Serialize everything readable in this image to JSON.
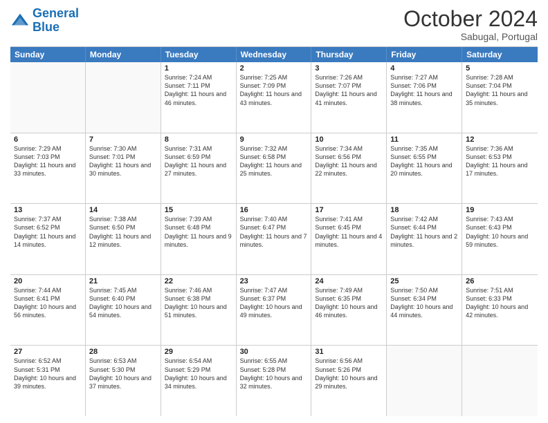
{
  "logo": {
    "line1": "General",
    "line2": "Blue"
  },
  "header": {
    "month": "October 2024",
    "location": "Sabugal, Portugal"
  },
  "weekdays": [
    "Sunday",
    "Monday",
    "Tuesday",
    "Wednesday",
    "Thursday",
    "Friday",
    "Saturday"
  ],
  "rows": [
    [
      {
        "day": "",
        "sunrise": "",
        "sunset": "",
        "daylight": "",
        "empty": true
      },
      {
        "day": "",
        "sunrise": "",
        "sunset": "",
        "daylight": "",
        "empty": true
      },
      {
        "day": "1",
        "sunrise": "Sunrise: 7:24 AM",
        "sunset": "Sunset: 7:11 PM",
        "daylight": "Daylight: 11 hours and 46 minutes."
      },
      {
        "day": "2",
        "sunrise": "Sunrise: 7:25 AM",
        "sunset": "Sunset: 7:09 PM",
        "daylight": "Daylight: 11 hours and 43 minutes."
      },
      {
        "day": "3",
        "sunrise": "Sunrise: 7:26 AM",
        "sunset": "Sunset: 7:07 PM",
        "daylight": "Daylight: 11 hours and 41 minutes."
      },
      {
        "day": "4",
        "sunrise": "Sunrise: 7:27 AM",
        "sunset": "Sunset: 7:06 PM",
        "daylight": "Daylight: 11 hours and 38 minutes."
      },
      {
        "day": "5",
        "sunrise": "Sunrise: 7:28 AM",
        "sunset": "Sunset: 7:04 PM",
        "daylight": "Daylight: 11 hours and 35 minutes."
      }
    ],
    [
      {
        "day": "6",
        "sunrise": "Sunrise: 7:29 AM",
        "sunset": "Sunset: 7:03 PM",
        "daylight": "Daylight: 11 hours and 33 minutes."
      },
      {
        "day": "7",
        "sunrise": "Sunrise: 7:30 AM",
        "sunset": "Sunset: 7:01 PM",
        "daylight": "Daylight: 11 hours and 30 minutes."
      },
      {
        "day": "8",
        "sunrise": "Sunrise: 7:31 AM",
        "sunset": "Sunset: 6:59 PM",
        "daylight": "Daylight: 11 hours and 27 minutes."
      },
      {
        "day": "9",
        "sunrise": "Sunrise: 7:32 AM",
        "sunset": "Sunset: 6:58 PM",
        "daylight": "Daylight: 11 hours and 25 minutes."
      },
      {
        "day": "10",
        "sunrise": "Sunrise: 7:34 AM",
        "sunset": "Sunset: 6:56 PM",
        "daylight": "Daylight: 11 hours and 22 minutes."
      },
      {
        "day": "11",
        "sunrise": "Sunrise: 7:35 AM",
        "sunset": "Sunset: 6:55 PM",
        "daylight": "Daylight: 11 hours and 20 minutes."
      },
      {
        "day": "12",
        "sunrise": "Sunrise: 7:36 AM",
        "sunset": "Sunset: 6:53 PM",
        "daylight": "Daylight: 11 hours and 17 minutes."
      }
    ],
    [
      {
        "day": "13",
        "sunrise": "Sunrise: 7:37 AM",
        "sunset": "Sunset: 6:52 PM",
        "daylight": "Daylight: 11 hours and 14 minutes."
      },
      {
        "day": "14",
        "sunrise": "Sunrise: 7:38 AM",
        "sunset": "Sunset: 6:50 PM",
        "daylight": "Daylight: 11 hours and 12 minutes."
      },
      {
        "day": "15",
        "sunrise": "Sunrise: 7:39 AM",
        "sunset": "Sunset: 6:48 PM",
        "daylight": "Daylight: 11 hours and 9 minutes."
      },
      {
        "day": "16",
        "sunrise": "Sunrise: 7:40 AM",
        "sunset": "Sunset: 6:47 PM",
        "daylight": "Daylight: 11 hours and 7 minutes."
      },
      {
        "day": "17",
        "sunrise": "Sunrise: 7:41 AM",
        "sunset": "Sunset: 6:45 PM",
        "daylight": "Daylight: 11 hours and 4 minutes."
      },
      {
        "day": "18",
        "sunrise": "Sunrise: 7:42 AM",
        "sunset": "Sunset: 6:44 PM",
        "daylight": "Daylight: 11 hours and 2 minutes."
      },
      {
        "day": "19",
        "sunrise": "Sunrise: 7:43 AM",
        "sunset": "Sunset: 6:43 PM",
        "daylight": "Daylight: 10 hours and 59 minutes."
      }
    ],
    [
      {
        "day": "20",
        "sunrise": "Sunrise: 7:44 AM",
        "sunset": "Sunset: 6:41 PM",
        "daylight": "Daylight: 10 hours and 56 minutes."
      },
      {
        "day": "21",
        "sunrise": "Sunrise: 7:45 AM",
        "sunset": "Sunset: 6:40 PM",
        "daylight": "Daylight: 10 hours and 54 minutes."
      },
      {
        "day": "22",
        "sunrise": "Sunrise: 7:46 AM",
        "sunset": "Sunset: 6:38 PM",
        "daylight": "Daylight: 10 hours and 51 minutes."
      },
      {
        "day": "23",
        "sunrise": "Sunrise: 7:47 AM",
        "sunset": "Sunset: 6:37 PM",
        "daylight": "Daylight: 10 hours and 49 minutes."
      },
      {
        "day": "24",
        "sunrise": "Sunrise: 7:49 AM",
        "sunset": "Sunset: 6:35 PM",
        "daylight": "Daylight: 10 hours and 46 minutes."
      },
      {
        "day": "25",
        "sunrise": "Sunrise: 7:50 AM",
        "sunset": "Sunset: 6:34 PM",
        "daylight": "Daylight: 10 hours and 44 minutes."
      },
      {
        "day": "26",
        "sunrise": "Sunrise: 7:51 AM",
        "sunset": "Sunset: 6:33 PM",
        "daylight": "Daylight: 10 hours and 42 minutes."
      }
    ],
    [
      {
        "day": "27",
        "sunrise": "Sunrise: 6:52 AM",
        "sunset": "Sunset: 5:31 PM",
        "daylight": "Daylight: 10 hours and 39 minutes."
      },
      {
        "day": "28",
        "sunrise": "Sunrise: 6:53 AM",
        "sunset": "Sunset: 5:30 PM",
        "daylight": "Daylight: 10 hours and 37 minutes."
      },
      {
        "day": "29",
        "sunrise": "Sunrise: 6:54 AM",
        "sunset": "Sunset: 5:29 PM",
        "daylight": "Daylight: 10 hours and 34 minutes."
      },
      {
        "day": "30",
        "sunrise": "Sunrise: 6:55 AM",
        "sunset": "Sunset: 5:28 PM",
        "daylight": "Daylight: 10 hours and 32 minutes."
      },
      {
        "day": "31",
        "sunrise": "Sunrise: 6:56 AM",
        "sunset": "Sunset: 5:26 PM",
        "daylight": "Daylight: 10 hours and 29 minutes."
      },
      {
        "day": "",
        "sunrise": "",
        "sunset": "",
        "daylight": "",
        "empty": true
      },
      {
        "day": "",
        "sunrise": "",
        "sunset": "",
        "daylight": "",
        "empty": true
      }
    ]
  ]
}
